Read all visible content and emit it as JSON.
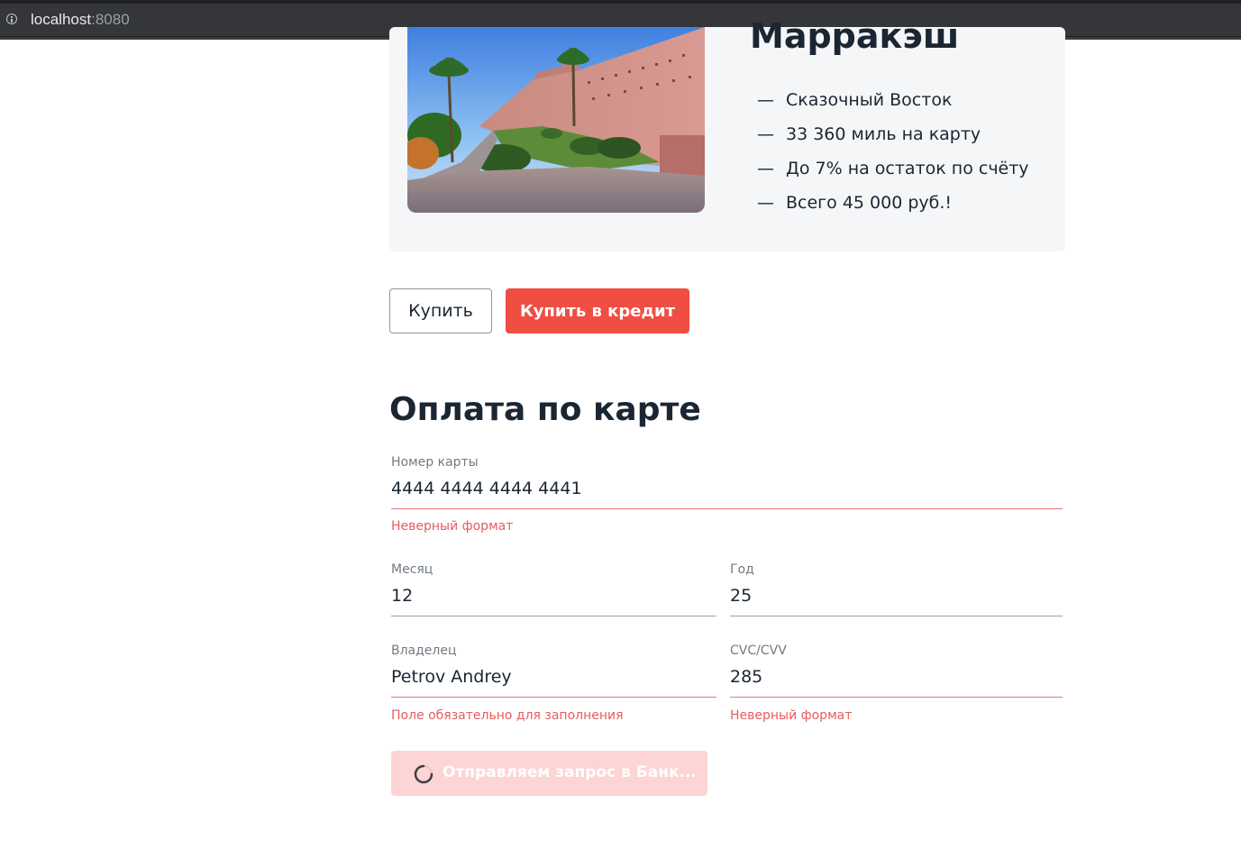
{
  "browser": {
    "url_host": "localhost",
    "url_port": ":8080"
  },
  "offer": {
    "title": "Марракэш",
    "features": [
      "Сказочный Восток",
      "33 360 миль на карту",
      "До 7% на остаток по счёту",
      "Всего 45 000 руб.!"
    ],
    "feature_dash": "—"
  },
  "actions": {
    "buy_label": "Купить",
    "credit_label": "Купить в кредит"
  },
  "payment": {
    "title": "Оплата по карте",
    "card_number": {
      "label": "Номер карты",
      "value": "4444 4444 4444 4441",
      "error": "Неверный формат"
    },
    "month": {
      "label": "Месяц",
      "value": "12"
    },
    "year": {
      "label": "Год",
      "value": "25"
    },
    "owner": {
      "label": "Владелец",
      "value": "Petrov Andrey",
      "error": "Поле обязательно для заполнения"
    },
    "cvc": {
      "label": "CVC/CVV",
      "value": "285",
      "error": "Неверный формат"
    },
    "submit_label": "Отправляем запрос в Банк..."
  },
  "colors": {
    "accent": "#f04e43",
    "error": "#e85b5e",
    "card_bg": "#f5f6f8",
    "text": "#1b2633"
  }
}
